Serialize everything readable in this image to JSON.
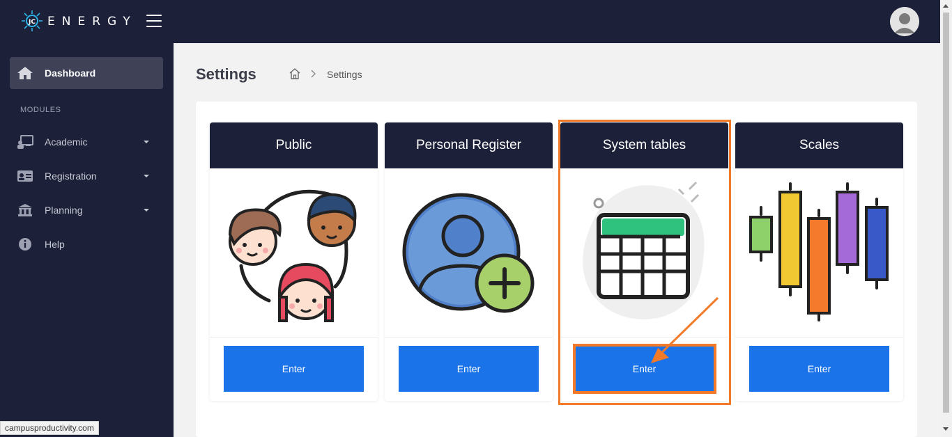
{
  "app": {
    "name": "ENERGY"
  },
  "sidebar": {
    "items": [
      {
        "label": "Dashboard",
        "icon": "home-icon"
      },
      {
        "label": "Academic",
        "icon": "teacher-icon"
      },
      {
        "label": "Registration",
        "icon": "id-card-icon"
      },
      {
        "label": "Planning",
        "icon": "bank-icon"
      },
      {
        "label": "Help",
        "icon": "info-icon"
      }
    ],
    "section": "MODULES"
  },
  "page": {
    "title": "Settings",
    "breadcrumb": {
      "current": "Settings"
    }
  },
  "cards": [
    {
      "title": "Public",
      "button": "Enter",
      "icon": "people-group-icon"
    },
    {
      "title": "Personal Register",
      "button": "Enter",
      "icon": "add-user-icon"
    },
    {
      "title": "System tables",
      "button": "Enter",
      "icon": "table-icon"
    },
    {
      "title": "Scales",
      "button": "Enter",
      "icon": "scale-bars-icon"
    }
  ],
  "colors": {
    "navy": "#1c2039",
    "button_blue": "#1a73e8",
    "highlight_orange": "#f37a28"
  },
  "status_bar": {
    "url": "campusproductivity.com"
  }
}
